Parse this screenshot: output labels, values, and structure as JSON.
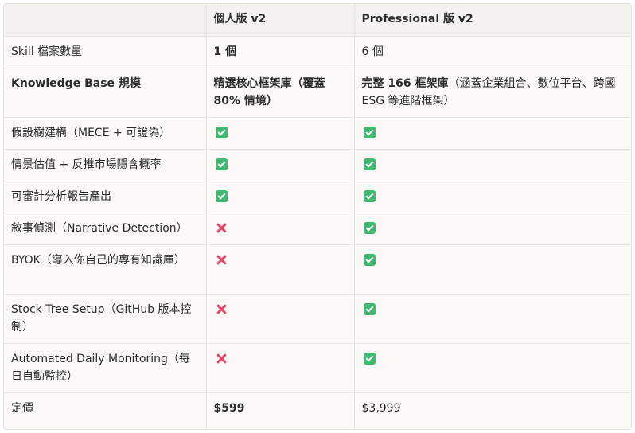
{
  "table": {
    "headers": [
      "",
      "個人版 v2",
      "Professional 版 v2"
    ],
    "rows": [
      {
        "feature": "Skill 檔案數量",
        "personal": "1 個",
        "professional": "6 個"
      },
      {
        "feature": "Knowledge Base 規模",
        "personal": "精選核心框架庫（覆蓋 80% 情境）",
        "professional_bold": "完整 166 框架庫",
        "professional_rest": "（涵蓋企業組合、數位平台、跨國 ESG 等進階框架）"
      },
      {
        "feature": "假設樹建構（MECE + 可證偽）",
        "personal": "check",
        "professional": "check"
      },
      {
        "feature": "情景估值 + 反推市場隱含概率",
        "personal": "check",
        "professional": "check"
      },
      {
        "feature": "可審計分析報告產出",
        "personal": "check",
        "professional": "check"
      },
      {
        "feature": "敘事偵測（Narrative Detection）",
        "personal": "cross",
        "professional": "check"
      },
      {
        "feature": "BYOK（導入你自己的專有知識庫）",
        "personal": "cross",
        "professional": "check"
      },
      {
        "feature": "Stock Tree Setup（GitHub 版本控制）",
        "personal": "cross",
        "professional": "check"
      },
      {
        "feature": "Automated Daily Monitoring（每日自動監控）",
        "personal": "cross",
        "professional": "check"
      },
      {
        "feature": "定價",
        "personal": "$599",
        "professional": "$3,999"
      }
    ]
  },
  "icons": {
    "check": "check-mark-icon",
    "cross": "cross-mark-icon"
  },
  "colors": {
    "check": "#3fb971",
    "cross": "#e2476a",
    "header_bg": "#f3f2ee",
    "border": "#e7e5df"
  }
}
